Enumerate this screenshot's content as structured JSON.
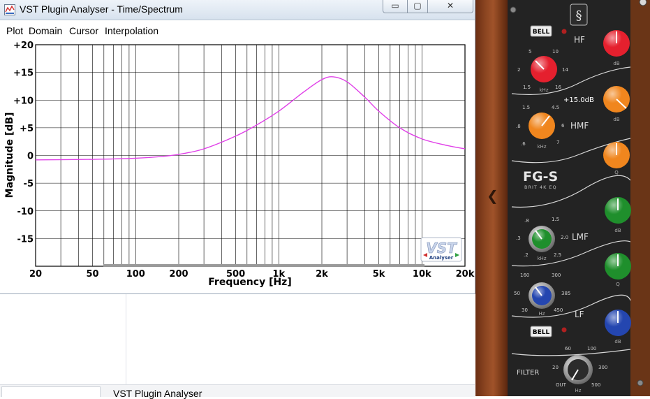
{
  "window": {
    "title": "VST Plugin Analyser - Time/Spectrum",
    "controls": {
      "minimize": "▭",
      "maximize": "▢",
      "close": "✕"
    }
  },
  "menu": [
    "Plot",
    "Domain",
    "Cursor",
    "Interpolation"
  ],
  "plot": {
    "y_axis_label": "Magnitude [dB]",
    "x_axis_label": "Frequency [Hz]",
    "y_ticks": [
      "+20",
      "+15",
      "+10",
      "+5",
      "0",
      "-5",
      "-10",
      "-15"
    ],
    "x_ticks": [
      "20",
      "50",
      "100",
      "200",
      "500",
      "1k",
      "2k",
      "5k",
      "10k",
      "20k"
    ],
    "logo_text": "VST",
    "logo_sub": "Analyser",
    "curve_color": "#e040e8"
  },
  "chart_data": {
    "type": "line",
    "x_scale": "log",
    "xlim": [
      20,
      20000
    ],
    "ylim": [
      -20,
      20
    ],
    "xlabel": "Frequency [Hz]",
    "ylabel": "Magnitude [dB]",
    "grid": true,
    "series": [
      {
        "x": [
          20,
          50,
          100,
          150,
          200,
          300,
          500,
          700,
          1000,
          1500,
          2000,
          2400,
          3000,
          4000,
          5000,
          7000,
          10000,
          15000,
          20000
        ],
        "y": [
          -0.8,
          -0.7,
          -0.5,
          -0.2,
          0.2,
          1.2,
          3.5,
          5.5,
          8.0,
          11.5,
          13.7,
          14.2,
          13.3,
          10.5,
          8.0,
          5.0,
          3.0,
          1.8,
          1.2
        ]
      }
    ]
  },
  "taskbar": {
    "label": "VST Plugin Analyser"
  },
  "plugin": {
    "name": "FG-S",
    "subtitle": "BRIT 4K EQ",
    "sections": {
      "hf": {
        "label": "HF",
        "bell_label": "BELL",
        "freq_ticks": [
          "1.5",
          "2",
          "5",
          "10",
          "14",
          "16"
        ],
        "freq_unit": "kHz",
        "gain_unit": "dB",
        "gain_color": "#e5202e",
        "freq_color": "#e5202e"
      },
      "hmf": {
        "label": "HMF",
        "readout": "+15.0dB",
        "freq_ticks": [
          ".6",
          ".8",
          "1.5",
          "4.5",
          "6",
          "7"
        ],
        "freq_unit": "kHz",
        "gain_unit": "dB",
        "q_unit": "Q",
        "color": "#f0861e"
      },
      "lmf": {
        "label": "LMF",
        "freq_ticks": [
          ".2",
          ".3",
          ".8",
          "1.5",
          "2.0",
          "2.5"
        ],
        "freq_unit": "kHz",
        "gain_unit": "dB",
        "q_unit": "Q",
        "color": "#1f8f2c"
      },
      "lf": {
        "label": "LF",
        "bell_label": "BELL",
        "freq_ticks": [
          "30",
          "50",
          "160",
          "300",
          "385",
          "450"
        ],
        "freq_unit": "Hz",
        "gain_unit": "dB",
        "color": "#2446b0"
      },
      "filter": {
        "label": "FILTER",
        "ticks": [
          "OUT",
          "20",
          "60",
          "100",
          "300",
          "500"
        ],
        "unit": "Hz"
      }
    }
  }
}
